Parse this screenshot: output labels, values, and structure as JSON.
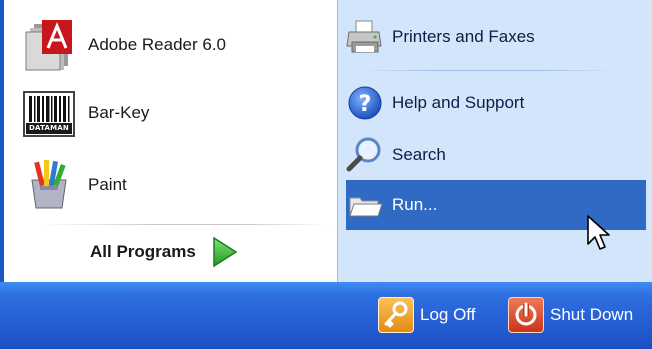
{
  "start_menu": {
    "pinned_programs": [
      {
        "label": "Adobe Reader 6.0",
        "icon": "adobe-reader-icon"
      },
      {
        "label": "Bar-Key",
        "icon": "barcode-dataman-icon"
      },
      {
        "label": "Paint",
        "icon": "paint-brushes-icon"
      }
    ],
    "all_programs": {
      "label": "All Programs",
      "icon": "green-arrow-icon"
    },
    "places": [
      {
        "label": "Printers and Faxes",
        "icon": "printer-icon"
      },
      {
        "label": "Help and Support",
        "icon": "help-icon"
      },
      {
        "label": "Search",
        "icon": "search-icon"
      },
      {
        "label": "Run...",
        "icon": "run-icon",
        "selected": true
      }
    ],
    "bottom_bar": {
      "log_off": {
        "label": "Log Off",
        "icon": "key-icon"
      },
      "shut_down": {
        "label": "Shut Down",
        "icon": "power-icon"
      }
    },
    "barcode_brand": "DATAMAN",
    "adobe_logo_text": "Adobe",
    "colors": {
      "xp_blue": "#225bd0",
      "places_bg": "#d3e5fa",
      "selection": "#316ac5",
      "log_off_orange": "#f1a22b",
      "shut_down_red": "#d8441f"
    }
  }
}
